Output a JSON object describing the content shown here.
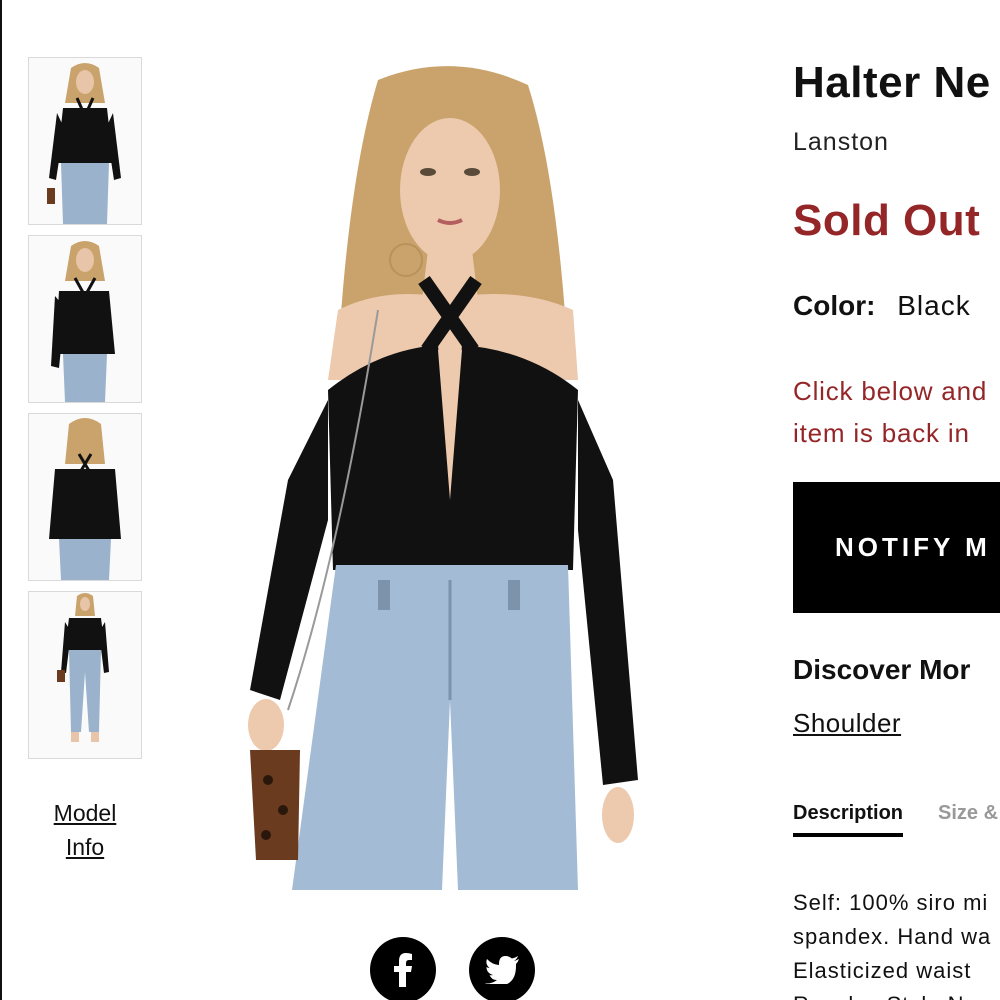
{
  "thumbnails": [
    {
      "alt": "front view"
    },
    {
      "alt": "side view"
    },
    {
      "alt": "back view"
    },
    {
      "alt": "full body view"
    }
  ],
  "model_info": {
    "line1": "Model",
    "line2": "Info"
  },
  "product": {
    "title": "Halter Ne",
    "brand": "Lanston",
    "status": "Sold Out",
    "color_label": "Color:",
    "color_value": "Black"
  },
  "notify": {
    "line1": "Click below and",
    "line2": "item is back in",
    "button_label": "NOTIFY M"
  },
  "discover": {
    "title": "Discover Mor",
    "link": "Shoulder"
  },
  "tabs": {
    "description": "Description",
    "size": "Size &"
  },
  "description": {
    "line1": "Self: 100% siro mi",
    "line2": "spandex. Hand wa",
    "line3": "Elasticized waist",
    "line4": "Revolve Style No"
  },
  "social": {
    "facebook_icon": "facebook-icon",
    "twitter_icon": "twitter-icon"
  },
  "colors": {
    "sold_out": "#952628",
    "button_bg": "#000000"
  }
}
